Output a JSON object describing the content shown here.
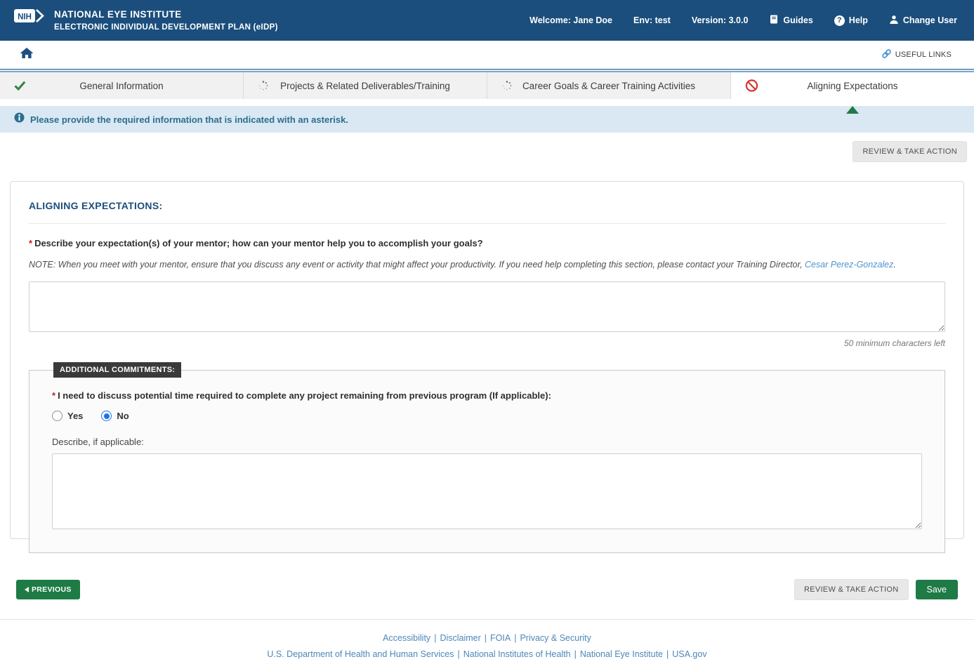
{
  "colors": {
    "header_navy": "#1b4e7c",
    "accent_green": "#1e7b46",
    "error_red": "#d9332e",
    "alert_bg": "#d9e8f2",
    "alert_text": "#2d6e8e",
    "link_blue": "#4d87b9",
    "radio_blue": "#1a73e8"
  },
  "icons": {
    "logo": "nih-logo",
    "guides": "book-icon",
    "help": "question-circle-icon",
    "change_user": "person-icon",
    "home": "home-icon",
    "useful_links": "link-icon",
    "tab_complete": "check-icon",
    "tab_in_progress": "spinner-dots-icon",
    "tab_error": "no-entry-icon",
    "alert": "info-circle-icon",
    "previous": "left-triangle-icon"
  },
  "header": {
    "logo_text": "NIH",
    "org": "NATIONAL EYE INSTITUTE",
    "app": "ELECTRONIC INDIVIDUAL DEVELOPMENT PLAN (eIDP)",
    "welcome": "Welcome: Jane Doe",
    "env": "Env: test",
    "version": "Version: 3.0.0",
    "guides": "Guides",
    "help": "Help",
    "help_glyph": "?",
    "change_user": "Change User"
  },
  "subheader": {
    "useful_links": "USEFUL LINKS"
  },
  "tabs": [
    {
      "label": "General Information",
      "status": "complete",
      "active": false
    },
    {
      "label": "Projects & Related Deliverables/Training",
      "status": "in-progress",
      "active": false
    },
    {
      "label": "Career Goals & Career Training Activities",
      "status": "in-progress",
      "active": false
    },
    {
      "label": "Aligning Expectations",
      "status": "error",
      "active": true
    }
  ],
  "alert": {
    "text": "Please provide the required information that is indicated with an asterisk."
  },
  "actions": {
    "review": "REVIEW & TAKE ACTION",
    "previous": "PREVIOUS",
    "save": "Save"
  },
  "form": {
    "required_marker": "*",
    "section_title": "ALIGNING EXPECTATIONS:",
    "question": "Describe your expectation(s) of your mentor; how can your mentor help you to accomplish your goals?",
    "note_prefix": "NOTE: When you meet with your mentor, ensure that you discuss any event or activity that might affect your productivity. If you need help completing this section, please contact your Training Director, ",
    "note_link": "Cesar Perez-Gonzalez",
    "note_suffix": ".",
    "mentor_value": "",
    "char_hint": "50 minimum characters left",
    "commitments": {
      "legend": "ADDITIONAL COMMITMENTS:",
      "question": "I need to discuss potential time required to complete any project remaining from previous program (If applicable):",
      "options": [
        {
          "label": "Yes",
          "checked": false
        },
        {
          "label": "No",
          "checked": true
        }
      ],
      "describe_label": "Describe, if applicable:",
      "describe_value": ""
    }
  },
  "footer": {
    "pipe": "|",
    "links_row1": [
      "Accessibility",
      "Disclaimer",
      "FOIA",
      "Privacy & Security"
    ],
    "links_row2": [
      "U.S. Department of Health and Human Services",
      "National Institutes of Health",
      "National Eye Institute",
      "USA.gov"
    ]
  }
}
